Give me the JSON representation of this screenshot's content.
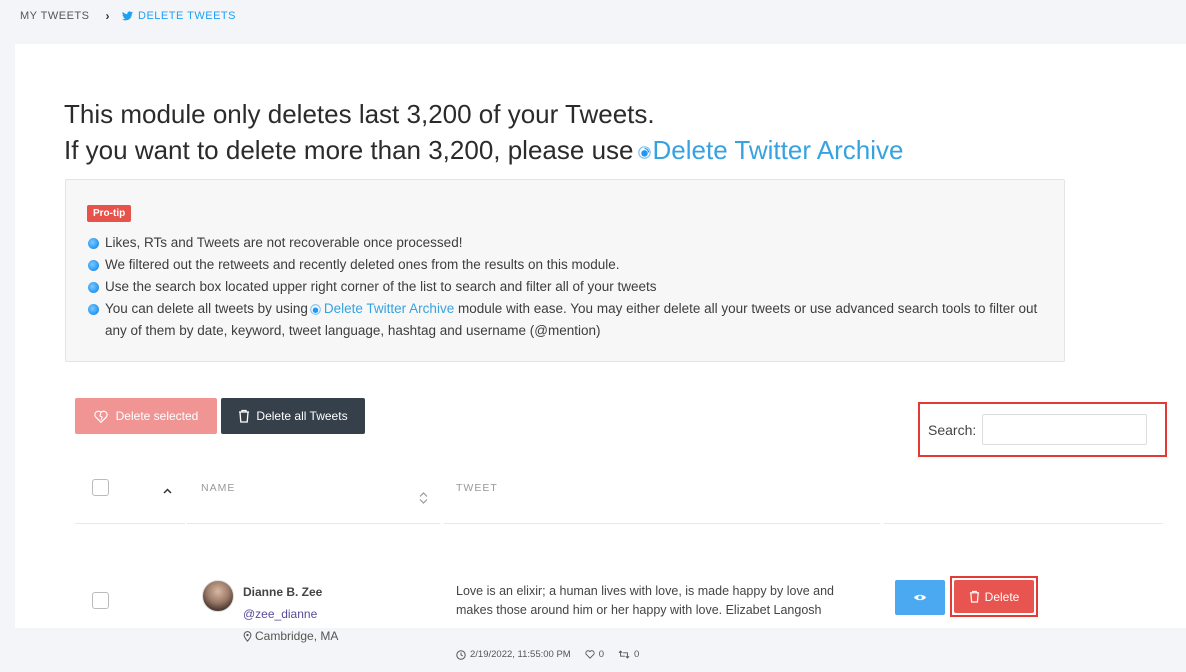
{
  "breadcrumb": {
    "home": "MY TWEETS",
    "current": "DELETE TWEETS"
  },
  "headline": {
    "line1": "This module only deletes last 3,200 of your Tweets.",
    "line2_prefix": "If you want to delete more than 3,200, please use",
    "line2_link": "Delete Twitter Archive"
  },
  "protip": {
    "badge": "Pro-tip",
    "items": [
      "Likes, RTs and Tweets are not recoverable once processed!",
      "We filtered out the retweets and recently deleted ones from the results on this module.",
      "Use the search box located upper right corner of the list to search and filter all of your tweets"
    ],
    "item4_prefix": "You can delete all tweets by using",
    "item4_link": "Delete Twitter Archive",
    "item4_suffix": "module with ease. You may either delete all your tweets or use advanced search tools to filter out any of them by date, keyword, tweet language, hashtag and username (@mention)"
  },
  "actions": {
    "delete_selected": "Delete selected",
    "delete_all": "Delete all Tweets"
  },
  "search": {
    "label": "Search:",
    "value": ""
  },
  "table": {
    "columns": {
      "name": "NAME",
      "tweet": "TWEET"
    },
    "rows": [
      {
        "name": "Dianne B. Zee",
        "handle": "@zee_dianne",
        "location": "Cambridge, MA",
        "tweet": "Love is an elixir; a human lives with love, is made happy by love and makes those around him or her happy with love. Elizabet Langosh",
        "date": "2/19/2022, 11:55:00 PM",
        "likes": "0",
        "retweets": "0",
        "delete_label": "Delete"
      }
    ]
  },
  "colors": {
    "accent": "#1da1f2",
    "danger": "#e85450",
    "highlight": "#e53935"
  }
}
